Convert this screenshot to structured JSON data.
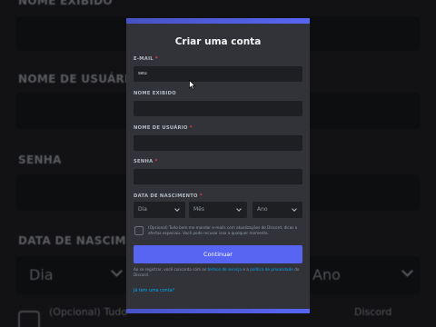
{
  "background": {
    "labels": [
      {
        "text": "NOME EXIBIDO"
      },
      {
        "text": "NOME DE USUÁRIO"
      },
      {
        "text": "SENHA"
      },
      {
        "text": "DATA DE NASCIMENTO"
      }
    ],
    "day_value": "Dia",
    "year_value": "Ano",
    "consent_left": "(Opcional) Tudo",
    "consent_right": "Discord"
  },
  "modal": {
    "title": "Criar uma conta",
    "email": {
      "label": "E-MAIL",
      "value": "seu"
    },
    "display_name": {
      "label": "NOME EXIBIDO",
      "value": ""
    },
    "username": {
      "label": "NOME DE USUÁRIO",
      "value": ""
    },
    "password": {
      "label": "SENHA",
      "value": ""
    },
    "birthdate": {
      "label": "DATA DE NASCIMENTO",
      "day": "Dia",
      "month": "Mês",
      "year": "Ano"
    },
    "required_mark": "*",
    "consent_text": "(Opcional) Tudo bem me mandar e-mails com atualizações do Discord, dicas e ofertas especiais. Você pode recusar isso a qualquer momento.",
    "continue_label": "Continuar",
    "terms_prefix": "Ao se registrar, você concorda com os ",
    "terms_link": "termos de serviço",
    "terms_middle": " e a ",
    "privacy_link": "política de privacidade",
    "terms_suffix": " do Discord.",
    "login_link": "Já tem uma conta?"
  },
  "colors": {
    "accent": "#5865f2",
    "modal_bg": "#313338",
    "input_bg": "#1e1f22",
    "link": "#00a8fc",
    "required": "#f23f43"
  }
}
